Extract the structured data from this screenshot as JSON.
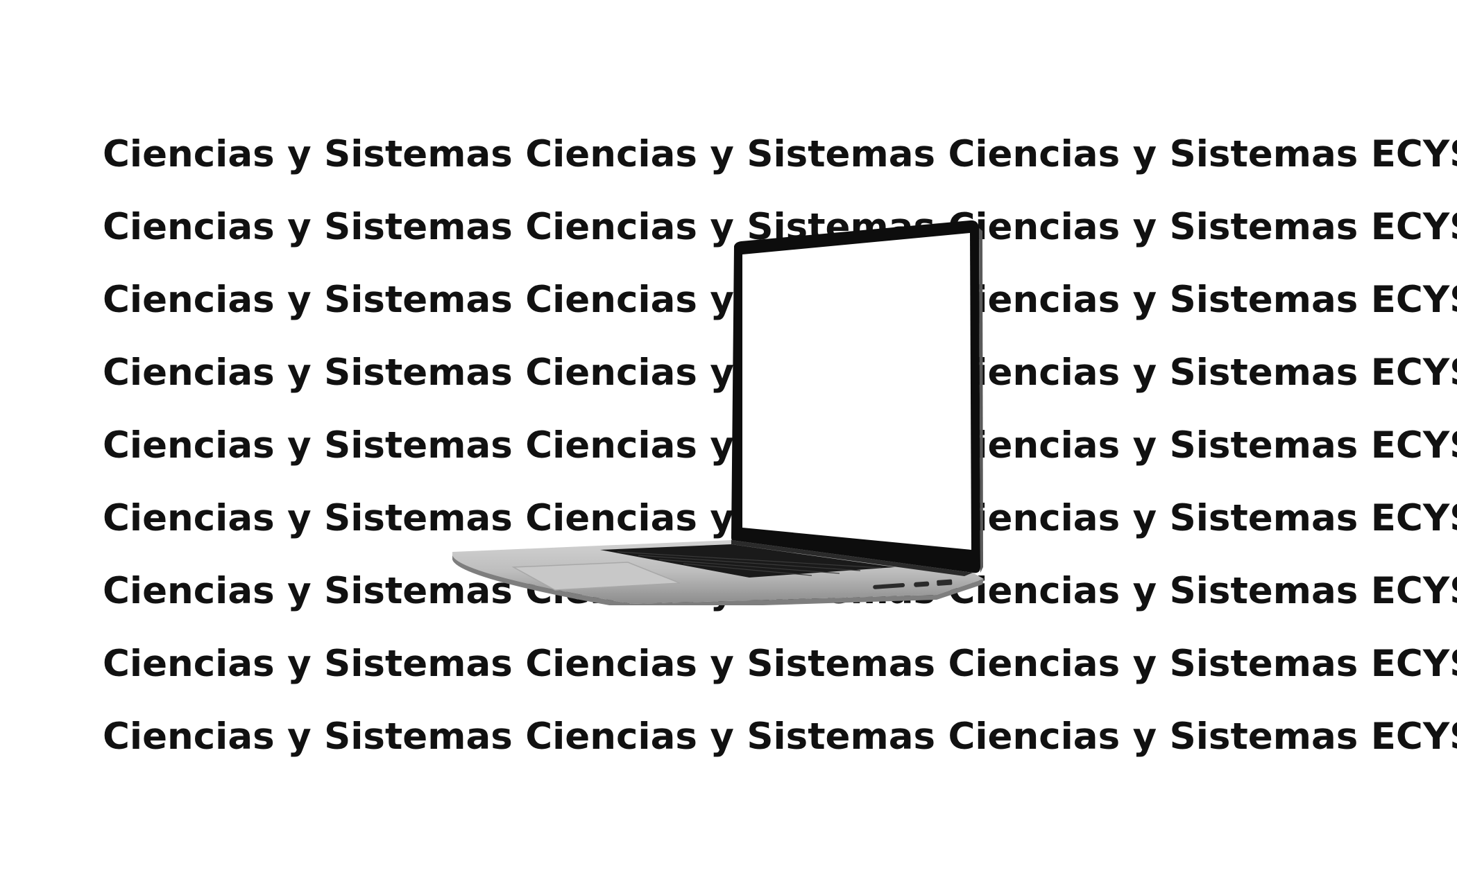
{
  "watermark": {
    "lines": [
      "Ciencias y Sistemas Ciencias y Sistemas Ciencias y Sistemas ECYS",
      "Ciencias y Sistemas Ciencias y Sistemas Ciencias y Sistemas ECYS",
      "Ciencias y Sistemas Ciencias y Sistemas Ciencias y Sistemas ECYS",
      "Ciencias y Sistemas Ciencias y Sistemas Ciencias y Sistemas ECYS",
      "Ciencias y Sistemas Ciencias y Sistemas Ciencias y Sistemas ECYS",
      "Ciencias y Sistemas Ciencias y Sistemas Ciencias y Sistemas ECYS",
      "Ciencias y Sistemas Ciencias y Sistemas Ciencias y Sistemas ECYS",
      "Ciencias y Sistemas Ciencias y Sistemas Ciencias y Sistemas ECYS",
      "Ciencias y Sistemas Ciencias y Sistemas Ciencias y Sistemas ECYS"
    ]
  },
  "image": {
    "subject": "laptop-icon"
  },
  "colors": {
    "background": "#ffffff",
    "text": "#111111",
    "bezel": "#0d0d0d",
    "body": "#b9b9b9",
    "keyboard": "#1a1a1a"
  }
}
